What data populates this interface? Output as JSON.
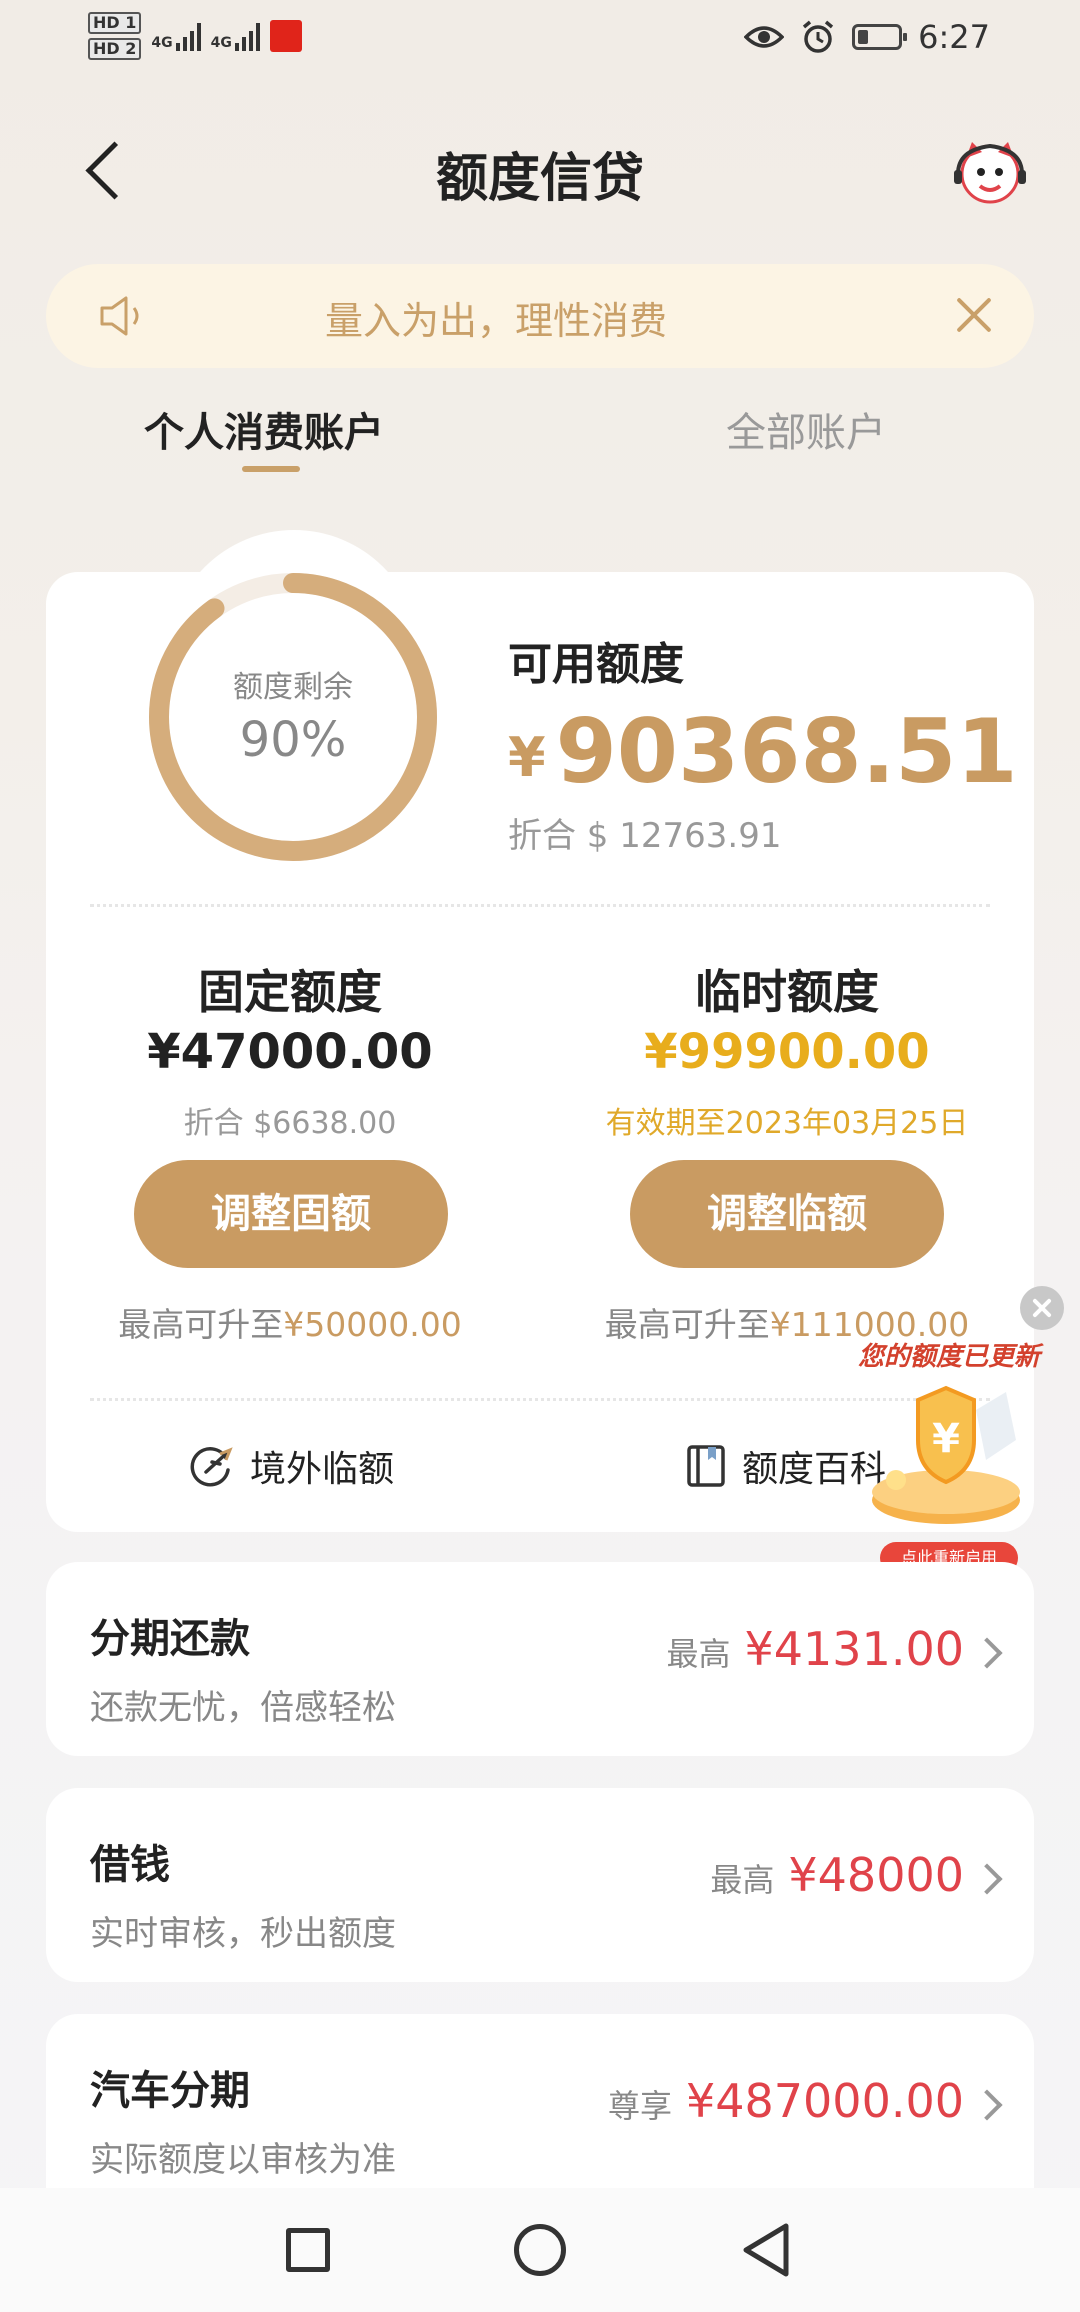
{
  "status_bar": {
    "hd1": "HD 1",
    "hd2": "HD 2",
    "net1": "4G",
    "net2": "4G",
    "time": "6:27",
    "icons": [
      "eye-icon",
      "alarm-icon",
      "battery-icon"
    ]
  },
  "header": {
    "title": "额度信贷",
    "back_icon": "back-arrow-icon",
    "service_icon": "customer-service-avatar-icon"
  },
  "notice": {
    "text": "量入为出，理性消费",
    "icon": "speaker-icon",
    "close_icon": "close-icon"
  },
  "tabs": [
    {
      "label": "个人消费账户",
      "active": true
    },
    {
      "label": "全部账户",
      "active": false
    }
  ],
  "credit": {
    "ring_label": "额度剩余",
    "ring_value": "90%",
    "ring_fraction": 0.9,
    "available_title": "可用额度",
    "currency_symbol": "¥",
    "available_amount": "90368.51",
    "available_usd": "折合 $ 12763.91"
  },
  "fixed": {
    "title": "固定额度",
    "amount": "¥47000.00",
    "sub": "折合 $6638.00",
    "button": "调整固额",
    "max_prefix": "最高可升至",
    "max_value": "¥50000.00"
  },
  "temporary": {
    "title": "临时额度",
    "amount": "¥99900.00",
    "sub": "有效期至2023年03月25日",
    "button": "调整临额",
    "max_prefix": "最高可升至",
    "max_value": "¥111000.00"
  },
  "utilities": [
    {
      "label": "境外临额",
      "icon": "globe-plane-icon"
    },
    {
      "label": "额度百科",
      "icon": "book-icon"
    }
  ],
  "float_promo": {
    "banner": "您的额度已更新",
    "tag": "点此重新启用",
    "icon": "shield-coin-icon"
  },
  "services": [
    {
      "title": "分期还款",
      "subtitle": "还款无忧，倍感轻松",
      "prefix": "最高",
      "amount": "¥4131.00"
    },
    {
      "title": "借钱",
      "subtitle": "实时审核，秒出额度",
      "prefix": "最高",
      "amount": "¥48000"
    },
    {
      "title": "汽车分期",
      "subtitle": "实际额度以审核为准",
      "prefix": "尊享",
      "amount": "¥487000.00"
    }
  ],
  "colors": {
    "gold": "#c99b62",
    "bright_gold": "#e8ad1c",
    "red": "#e0434a",
    "notice_bg": "#fcf4e4"
  }
}
